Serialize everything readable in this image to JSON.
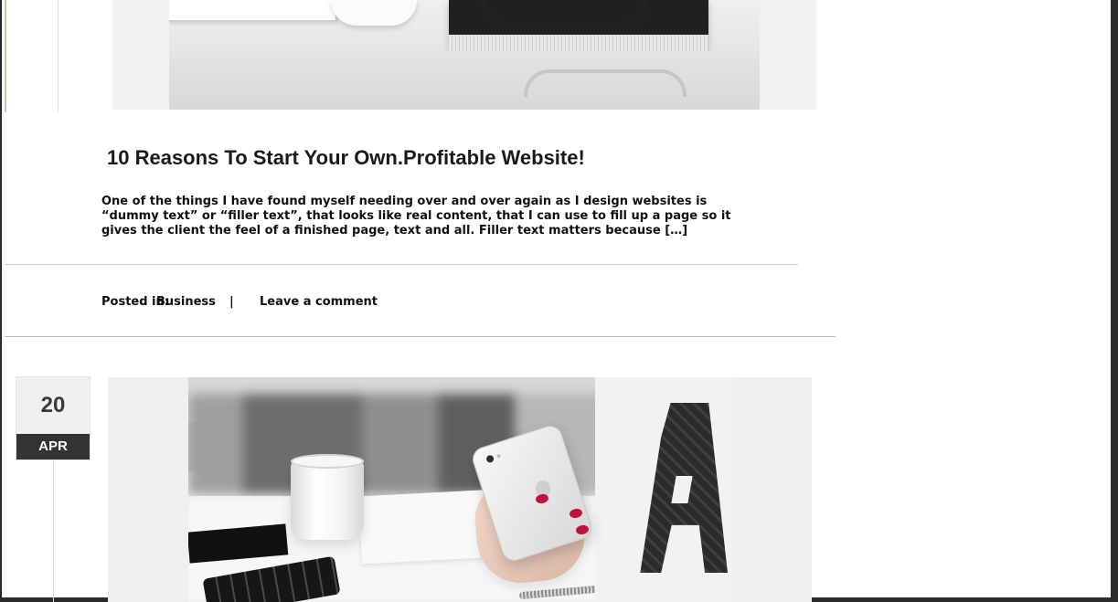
{
  "post1": {
    "title": "10 Reasons To Start Your Own.Profitable Website!",
    "excerpt": "One of the things I have found myself needing over and over again as I design websites is “dummy text” or “filler text”, that looks like real content, that I can use to fill up a page so it gives the client the feel of a finished page, text and all. Filler text matters because",
    "read_more": "[…]",
    "meta": {
      "posted_in_label": "Posted in:",
      "category": "Business",
      "separator": "|",
      "comment_link": "Leave a comment"
    }
  },
  "post2": {
    "date": {
      "day": "20",
      "month": "APR"
    }
  },
  "colors": {
    "badge_day_bg": "#f0f0f0",
    "badge_month_bg": "#333333",
    "page_bg": "#ffffff",
    "text": "#111111"
  },
  "icons": {
    "window_edges": "window-frame"
  }
}
